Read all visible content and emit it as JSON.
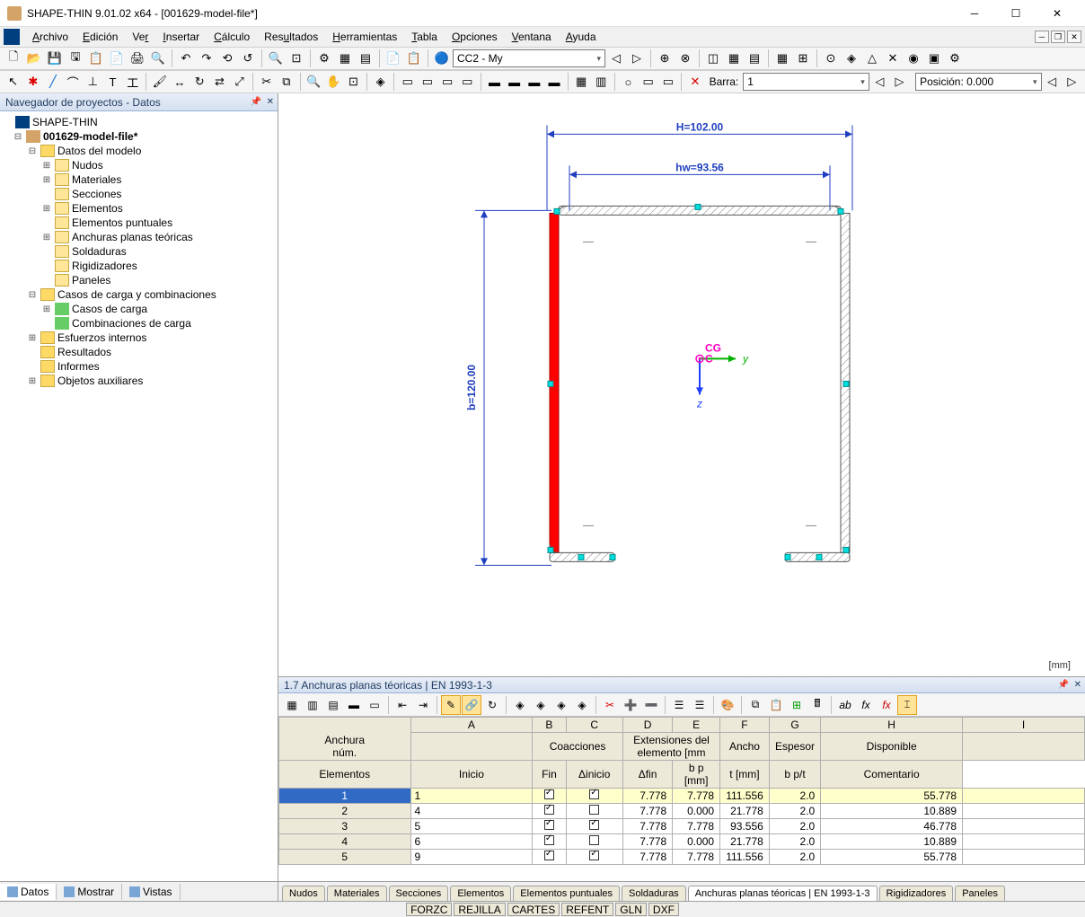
{
  "window": {
    "title": "SHAPE-THIN 9.01.02 x64 - [001629-model-file*]"
  },
  "menu": [
    "Archivo",
    "Edición",
    "Ver",
    "Insertar",
    "Cálculo",
    "Resultados",
    "Herramientas",
    "Tabla",
    "Opciones",
    "Ventana",
    "Ayuda"
  ],
  "toolbar1": {
    "combo": "CC2 - My"
  },
  "toolbar2": {
    "barra_label": "Barra:",
    "barra_value": "1",
    "posicion": "Posición: 0.000"
  },
  "navigator": {
    "title": "Navegador de proyectos - Datos",
    "root": "SHAPE-THIN",
    "model": "001629-model-file*",
    "n_datosmodelo": "Datos del modelo",
    "n_nudos": "Nudos",
    "n_materiales": "Materiales",
    "n_secciones": "Secciones",
    "n_elementos": "Elementos",
    "n_elementospunt": "Elementos puntuales",
    "n_anchuras": "Anchuras planas teóricas",
    "n_soldaduras": "Soldaduras",
    "n_rigidizadores": "Rigidizadores",
    "n_paneles": "Paneles",
    "n_casoscomb": "Casos de carga y combinaciones",
    "n_casoscarga": "Casos de carga",
    "n_combcarga": "Combinaciones de carga",
    "n_esfuerzos": "Esfuerzos internos",
    "n_resultados": "Resultados",
    "n_informes": "Informes",
    "n_objaux": "Objetos auxiliares",
    "tabs": {
      "datos": "Datos",
      "mostrar": "Mostrar",
      "vistas": "Vistas"
    }
  },
  "viewport": {
    "unit": "[mm]",
    "dim_H": "H=102.00",
    "dim_hw": "hw=93.56",
    "dim_b": "b=120.00",
    "axis_y": "y",
    "axis_z": "z",
    "cg": "CG",
    "c": "C"
  },
  "table": {
    "title": "1.7 Anchuras planas téoricas | EN 1993-1-3",
    "hdr_anchura": "Anchura",
    "hdr_num": "núm.",
    "hdr_elementos": "Elementos",
    "hdr_coacciones": "Coacciones",
    "hdr_inicio": "Inicio",
    "hdr_fin": "Fin",
    "hdr_extens": "Extensiones del elemento [mm",
    "hdr_dinicio": "Δinicio",
    "hdr_dfin": "Δfin",
    "hdr_ancho": "Ancho",
    "hdr_bp": "b p [mm]",
    "hdr_espesor": "Espesor",
    "hdr_t": "t [mm]",
    "hdr_disp": "Disponible",
    "hdr_bpt": "b p/t",
    "hdr_comentario": "Comentario",
    "cols": [
      "A",
      "B",
      "C",
      "D",
      "E",
      "F",
      "G",
      "H",
      "I"
    ],
    "rows": [
      {
        "idx": "1",
        "el": "1",
        "ci": true,
        "cf": true,
        "di": "7.778",
        "df": "7.778",
        "bp": "111.556",
        "t": "2.0",
        "bpt": "55.778"
      },
      {
        "idx": "2",
        "el": "4",
        "ci": true,
        "cf": false,
        "di": "7.778",
        "df": "0.000",
        "bp": "21.778",
        "t": "2.0",
        "bpt": "10.889"
      },
      {
        "idx": "3",
        "el": "5",
        "ci": true,
        "cf": true,
        "di": "7.778",
        "df": "7.778",
        "bp": "93.556",
        "t": "2.0",
        "bpt": "46.778"
      },
      {
        "idx": "4",
        "el": "6",
        "ci": true,
        "cf": false,
        "di": "7.778",
        "df": "0.000",
        "bp": "21.778",
        "t": "2.0",
        "bpt": "10.889"
      },
      {
        "idx": "5",
        "el": "9",
        "ci": true,
        "cf": true,
        "di": "7.778",
        "df": "7.778",
        "bp": "111.556",
        "t": "2.0",
        "bpt": "55.778"
      }
    ],
    "tabs": [
      "Nudos",
      "Materiales",
      "Secciones",
      "Elementos",
      "Elementos puntuales",
      "Soldaduras",
      "Anchuras planas téoricas | EN 1993-1-3",
      "Rigidizadores",
      "Paneles"
    ]
  },
  "status": [
    "FORZC",
    "REJILLA",
    "CARTES",
    "REFENT",
    "GLN",
    "DXF"
  ]
}
